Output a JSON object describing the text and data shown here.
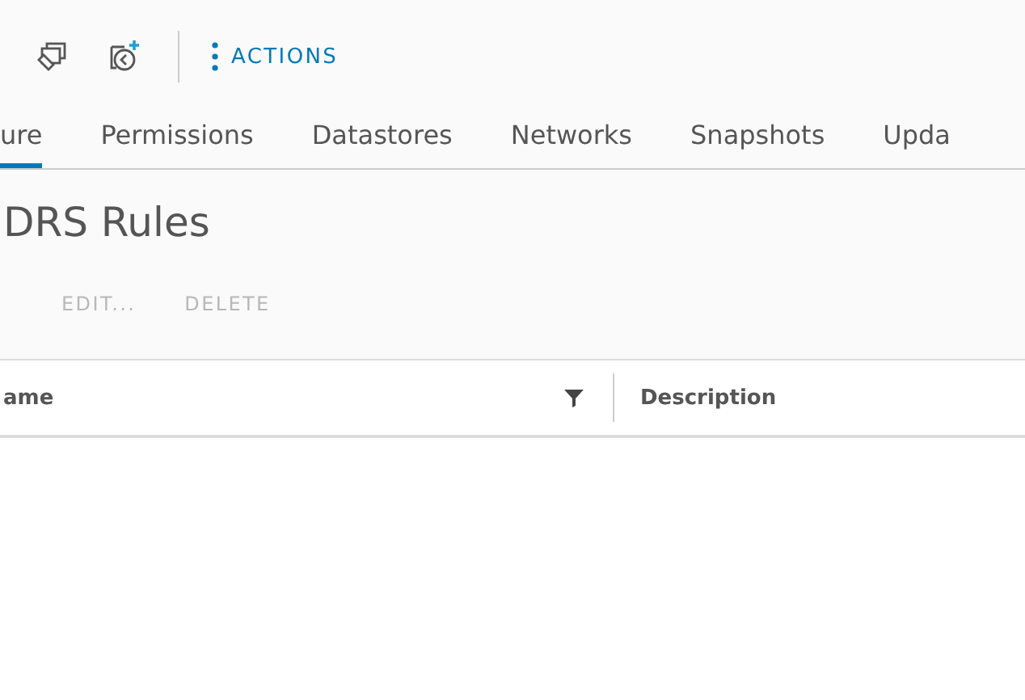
{
  "toolbar": {
    "actions_label": "ACTIONS"
  },
  "tabs": [
    {
      "label": "ure",
      "selected": true
    },
    {
      "label": "Permissions",
      "selected": false
    },
    {
      "label": "Datastores",
      "selected": false
    },
    {
      "label": "Networks",
      "selected": false
    },
    {
      "label": "Snapshots",
      "selected": false
    },
    {
      "label": "Upda",
      "selected": false
    }
  ],
  "title": "DRS Rules",
  "buttons": [
    {
      "label": "EDIT...",
      "disabled": true
    },
    {
      "label": "DELETE",
      "disabled": true
    }
  ],
  "table": {
    "columns": [
      {
        "label": "ame",
        "filterable": true
      },
      {
        "label": "Description",
        "filterable": false
      }
    ]
  }
}
